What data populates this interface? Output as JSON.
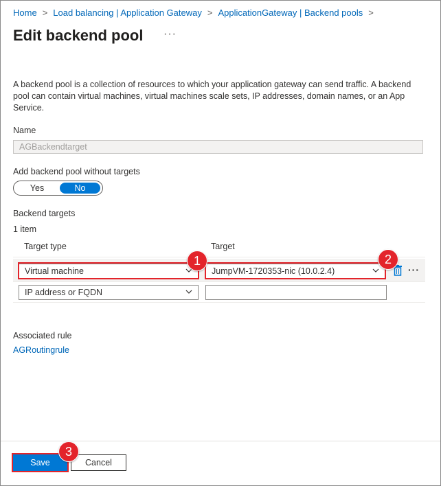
{
  "breadcrumb": {
    "items": [
      "Home",
      "Load balancing | Application Gateway",
      "ApplicationGateway | Backend pools"
    ],
    "separator": ">"
  },
  "page": {
    "title": "Edit backend pool",
    "more": "···"
  },
  "description": "A backend pool is a collection of resources to which your application gateway can send traffic. A backend pool can contain virtual machines, virtual machines scale sets, IP addresses, domain names, or an App Service.",
  "name_field": {
    "label": "Name",
    "value": "AGBackendtarget"
  },
  "without_targets": {
    "label": "Add backend pool without targets",
    "yes_label": "Yes",
    "no_label": "No",
    "selected": "No"
  },
  "backend_targets": {
    "section_label": "Backend targets",
    "count_text": "1 item",
    "columns": [
      "Target type",
      "Target"
    ],
    "rows": [
      {
        "target_type": "Virtual machine",
        "target": "JumpVM-1720353-nic (10.0.2.4)"
      },
      {
        "target_type": "IP address or FQDN",
        "target": ""
      }
    ],
    "row_more": "···",
    "icons": {
      "delete": "trash-icon",
      "dropdown": "chevron-down-icon"
    }
  },
  "associated_rule": {
    "label": "Associated rule",
    "link": "AGRoutingrule"
  },
  "footer": {
    "save_label": "Save",
    "cancel_label": "Cancel"
  },
  "callouts": [
    "1",
    "2",
    "3"
  ],
  "colors": {
    "accent": "#0078d4",
    "link": "#0067b8",
    "callout": "#e3242b"
  }
}
